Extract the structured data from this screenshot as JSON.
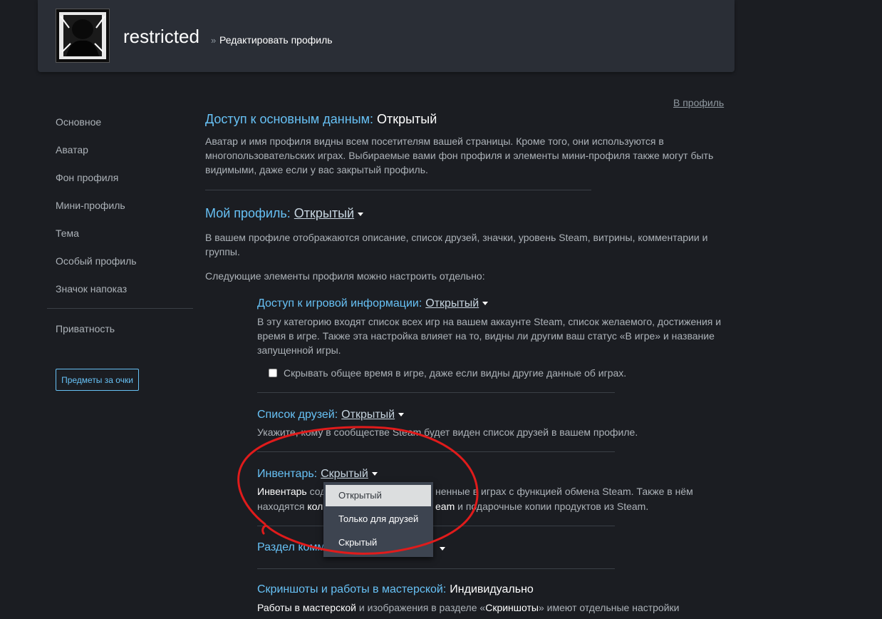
{
  "header": {
    "username": "restricted",
    "breadcrumb_sep": "»",
    "breadcrumb": "Редактировать профиль"
  },
  "back_link": "В профиль",
  "sidebar": {
    "items": [
      {
        "label": "Основное"
      },
      {
        "label": "Аватар"
      },
      {
        "label": "Фон профиля"
      },
      {
        "label": "Мини-профиль"
      },
      {
        "label": "Тема"
      },
      {
        "label": "Особый профиль"
      },
      {
        "label": "Значок напоказ"
      },
      {
        "label": "Приватность"
      }
    ],
    "points_button": "Предметы за очки"
  },
  "basic": {
    "title": "Доступ к основным данным:",
    "value": "Открытый",
    "desc": [
      "Аватар и имя профиля видны всем посетителям вашей страницы. Кроме того, они используются в",
      "многопользовательских играх. Выбираемые вами фон профиля и элементы мини-профиля также могут быть",
      "видимыми, даже если у вас закрытый профиль."
    ]
  },
  "my_profile": {
    "title": "Мой профиль:",
    "value": "Открытый",
    "desc": [
      "В вашем профиле отображаются описание, список друзей, значки, уровень Steam, витрины, комментарии и",
      "группы."
    ],
    "following": "Следующие элементы профиля можно настроить отдельно:"
  },
  "game_info": {
    "title": "Доступ к игровой информации:",
    "value": "Открытый",
    "desc": [
      "В эту категорию входят список всех игр на вашем аккаунте Steam, список желаемого, достижения и",
      "время в игре. Также эта настройка влияет на то, видны ли другим ваш статус «В игре» и название",
      "запущенной игры."
    ],
    "checkbox_label": "Скрывать общее время в игре, даже если видны другие данные об играх."
  },
  "friends": {
    "title": "Список друзей:",
    "value": "Открытый",
    "desc": "Укажите, кому в сообществе Steam будет виден список друзей в вашем профиле."
  },
  "inventory": {
    "title": "Инвентарь:",
    "value": "Скрытый",
    "desc1_bold": "Инвентарь",
    "desc1_a": "сод",
    "desc1_b": "ненные в играх с функцией обмена Steam. Также в нём",
    "desc2_a": "находятся",
    "desc2_bold_a": "кол",
    "desc2_bold_b": "eam",
    "desc2_b": "и подарочные копии продуктов из Steam."
  },
  "dropdown": {
    "options": [
      "Открытый",
      "Только для друзей",
      "Скрытый"
    ],
    "highlighted": "Открытый"
  },
  "comments": {
    "title_partial": "Раздел комм"
  },
  "screenshots": {
    "title": "Скриншоты и работы в мастерской:",
    "value": "Индивидуально",
    "desc_bold1": "Работы в мастерской",
    "desc_a": "и изображения в разделе «",
    "desc_bold2": "Скриншоты",
    "desc_b": "» имеют отдельные настройки"
  },
  "annotation_color": "#e01b1b"
}
